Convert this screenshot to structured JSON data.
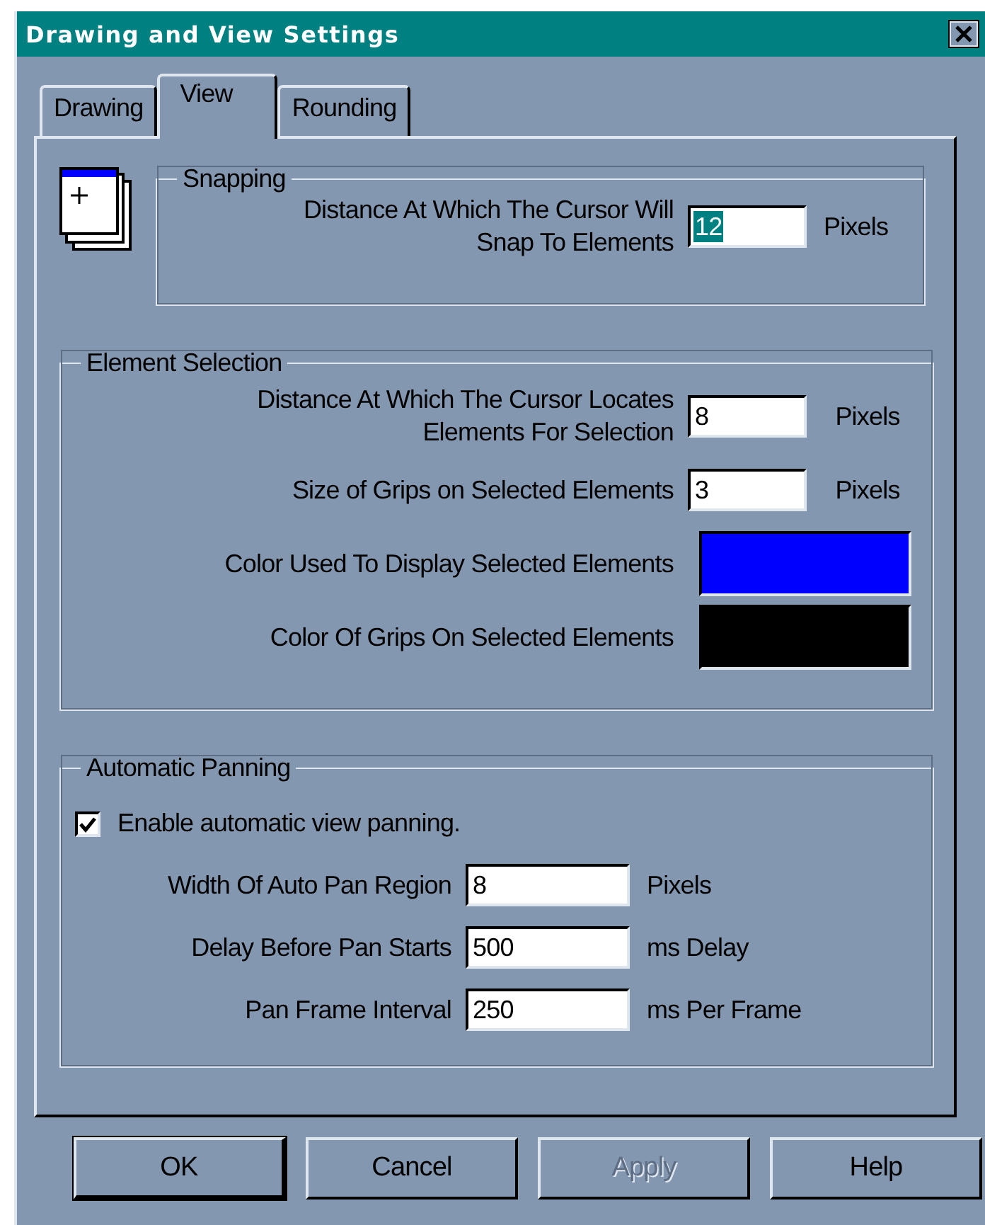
{
  "window": {
    "title": "Drawing and View Settings"
  },
  "tabs": [
    {
      "label": "Drawing",
      "selected": false
    },
    {
      "label": "View",
      "selected": true
    },
    {
      "label": "Rounding",
      "selected": false
    }
  ],
  "snapping": {
    "title": "Snapping",
    "rows": [
      {
        "kind": "number",
        "label": "Distance At Which The Cursor Will\nSnap To Elements",
        "value": "12",
        "value_selected": true,
        "unit": "Pixels"
      }
    ]
  },
  "element_selection": {
    "title": "Element Selection",
    "rows": [
      {
        "kind": "number",
        "label": "Distance At Which The Cursor Locates\nElements For Selection",
        "value": "8",
        "value_selected": false,
        "unit": "Pixels"
      },
      {
        "kind": "number",
        "label": "Size of Grips on Selected Elements",
        "value": "3",
        "value_selected": false,
        "unit": "Pixels"
      },
      {
        "kind": "color",
        "label": "Color Used To Display Selected Elements",
        "color": "#0000ff"
      },
      {
        "kind": "color",
        "label": "Color Of Grips On Selected Elements",
        "color": "#000000"
      }
    ]
  },
  "automatic_panning": {
    "title": "Automatic Panning",
    "checkbox": {
      "label": "Enable automatic view panning.",
      "checked": true
    },
    "rows": [
      {
        "kind": "number",
        "label": "Width Of Auto Pan Region",
        "value": "8",
        "value_selected": false,
        "unit": "Pixels"
      },
      {
        "kind": "number",
        "label": "Delay Before Pan Starts",
        "value": "500",
        "value_selected": false,
        "unit": "ms Delay"
      },
      {
        "kind": "number",
        "label": "Pan Frame Interval",
        "value": "250",
        "value_selected": false,
        "unit": "ms Per Frame"
      }
    ]
  },
  "buttons": [
    {
      "label": "OK",
      "disabled": false,
      "default": true
    },
    {
      "label": "Cancel",
      "disabled": false,
      "default": false
    },
    {
      "label": "Apply",
      "disabled": true,
      "default": false
    },
    {
      "label": "Help",
      "disabled": false,
      "default": false
    }
  ]
}
